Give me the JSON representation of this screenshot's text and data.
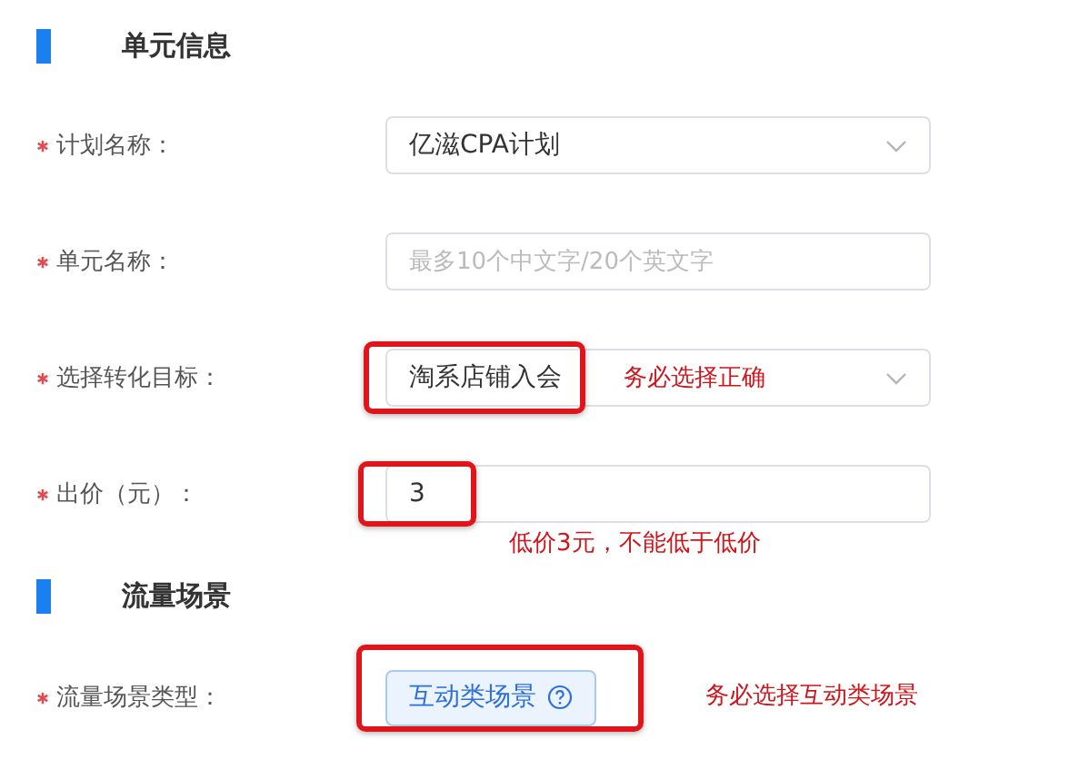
{
  "sections": [
    {
      "title": "单元信息",
      "fields": [
        {
          "kind": "select",
          "label": "计划名称：",
          "required": true,
          "value": "亿滋CPA计划"
        },
        {
          "kind": "input",
          "label": "单元名称：",
          "required": true,
          "placeholder": "最多10个中文字/20个英文字"
        },
        {
          "kind": "select",
          "label": "选择转化目标：",
          "required": true,
          "value": "淘系店铺入会",
          "note": "务必选择正确"
        },
        {
          "kind": "input",
          "label": "出价（元）：",
          "required": true,
          "value": "3",
          "note": "低价3元，不能低于低价"
        }
      ]
    },
    {
      "title": "流量场景",
      "fields": [
        {
          "kind": "tag",
          "label": "流量场景类型：",
          "required": true,
          "value": "互动类场景",
          "note": "务必选择互动类场景"
        }
      ]
    }
  ]
}
